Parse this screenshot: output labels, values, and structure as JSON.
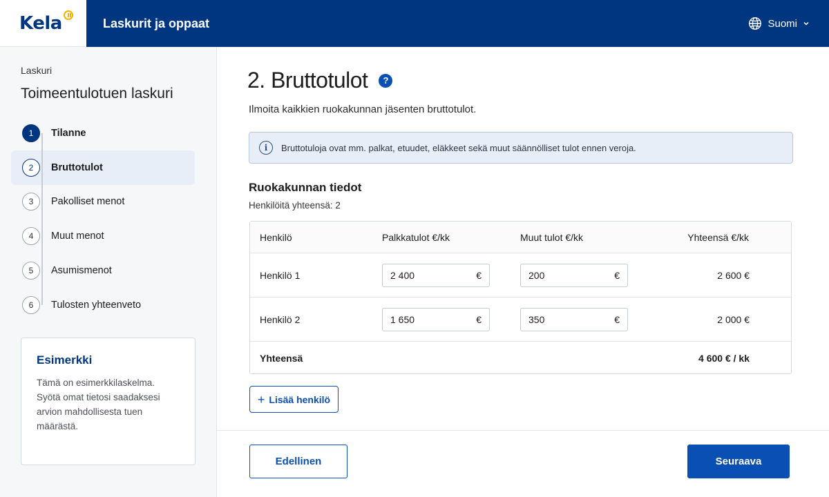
{
  "brand": {
    "logo": "Kela",
    "accent": "#003580",
    "button": "#0a4fb3",
    "logo_mark": "#f0b400"
  },
  "header": {
    "title": "Laskurit ja oppaat",
    "language": "Suomi",
    "language_icon": "globe-icon"
  },
  "sidebar": {
    "breadcrumb": "Laskuri",
    "title": "Toimeentulotuen laskuri",
    "steps": [
      {
        "num": "1",
        "label": "Tilanne",
        "state": "done"
      },
      {
        "num": "2",
        "label": "Bruttotulot",
        "state": "active"
      },
      {
        "num": "3",
        "label": "Pakolliset menot",
        "state": "todo"
      },
      {
        "num": "4",
        "label": "Muut menot",
        "state": "todo"
      },
      {
        "num": "5",
        "label": "Asumismenot",
        "state": "todo"
      },
      {
        "num": "6",
        "label": "Tulosten yhteenveto",
        "state": "todo"
      }
    ],
    "example": {
      "title": "Esimerkki",
      "text": "Tämä on esimerkkilaskelma. Syötä omat tietosi saadaksesi arvion mahdollisesta tuen määrästä."
    }
  },
  "main": {
    "title": "2. Bruttotulot",
    "help_icon": "?",
    "lead": "Ilmoita kaikkien ruokakunnan jäsenten bruttotulot.",
    "info": {
      "icon": "i",
      "text": "Bruttotuloja ovat mm. palkat, etuudet, eläkkeet sekä muut säännölliset tulot ennen veroja."
    },
    "section": {
      "title": "Ruokakunnan tiedot",
      "subtitle": "Henkilöitä yhteensä: 2"
    },
    "table": {
      "headers": [
        "Henkilö",
        "Palkkatulot €/kk",
        "Muut tulot €/kk",
        "Yhteensä €/kk"
      ],
      "rows": [
        {
          "person": "Henkilö 1",
          "salary": "2 400",
          "other": "200",
          "total": "2 600 €"
        },
        {
          "person": "Henkilö 2",
          "salary": "1 650",
          "other": "350",
          "total": "2 000 €"
        }
      ],
      "currency": "€",
      "total_label": "Yhteensä",
      "total_value": "4 600 € / kk"
    },
    "add_button": {
      "plus": "+",
      "label": "Lisää henkilö"
    }
  },
  "footer": {
    "prev": "Edellinen",
    "next": "Seuraava"
  }
}
